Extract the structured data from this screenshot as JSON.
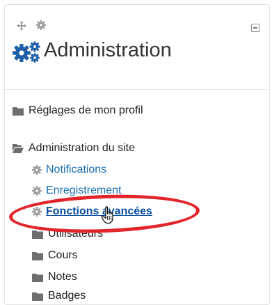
{
  "block": {
    "title": "Administration",
    "icons": {
      "move": "move-icon",
      "settings": "gear-icon",
      "collapse": "collapse-icon"
    }
  },
  "nav": {
    "profile_settings": "Réglages de mon profil",
    "site_admin": "Administration du site",
    "items": [
      {
        "label": "Notifications",
        "icon": "gear-icon"
      },
      {
        "label": "Enregistrement",
        "icon": "gear-icon"
      },
      {
        "label": "Fonctions avancées",
        "icon": "gear-icon",
        "highlighted": true
      },
      {
        "label": "Utilisateurs",
        "icon": "folder-icon"
      },
      {
        "label": "Cours",
        "icon": "folder-icon"
      },
      {
        "label": "Notes",
        "icon": "folder-icon"
      },
      {
        "label": "Badges",
        "icon": "folder-icon"
      }
    ]
  },
  "colors": {
    "link": "#1a6fb3",
    "annotation": "#e2252b",
    "folder": "#6e6e6e"
  }
}
